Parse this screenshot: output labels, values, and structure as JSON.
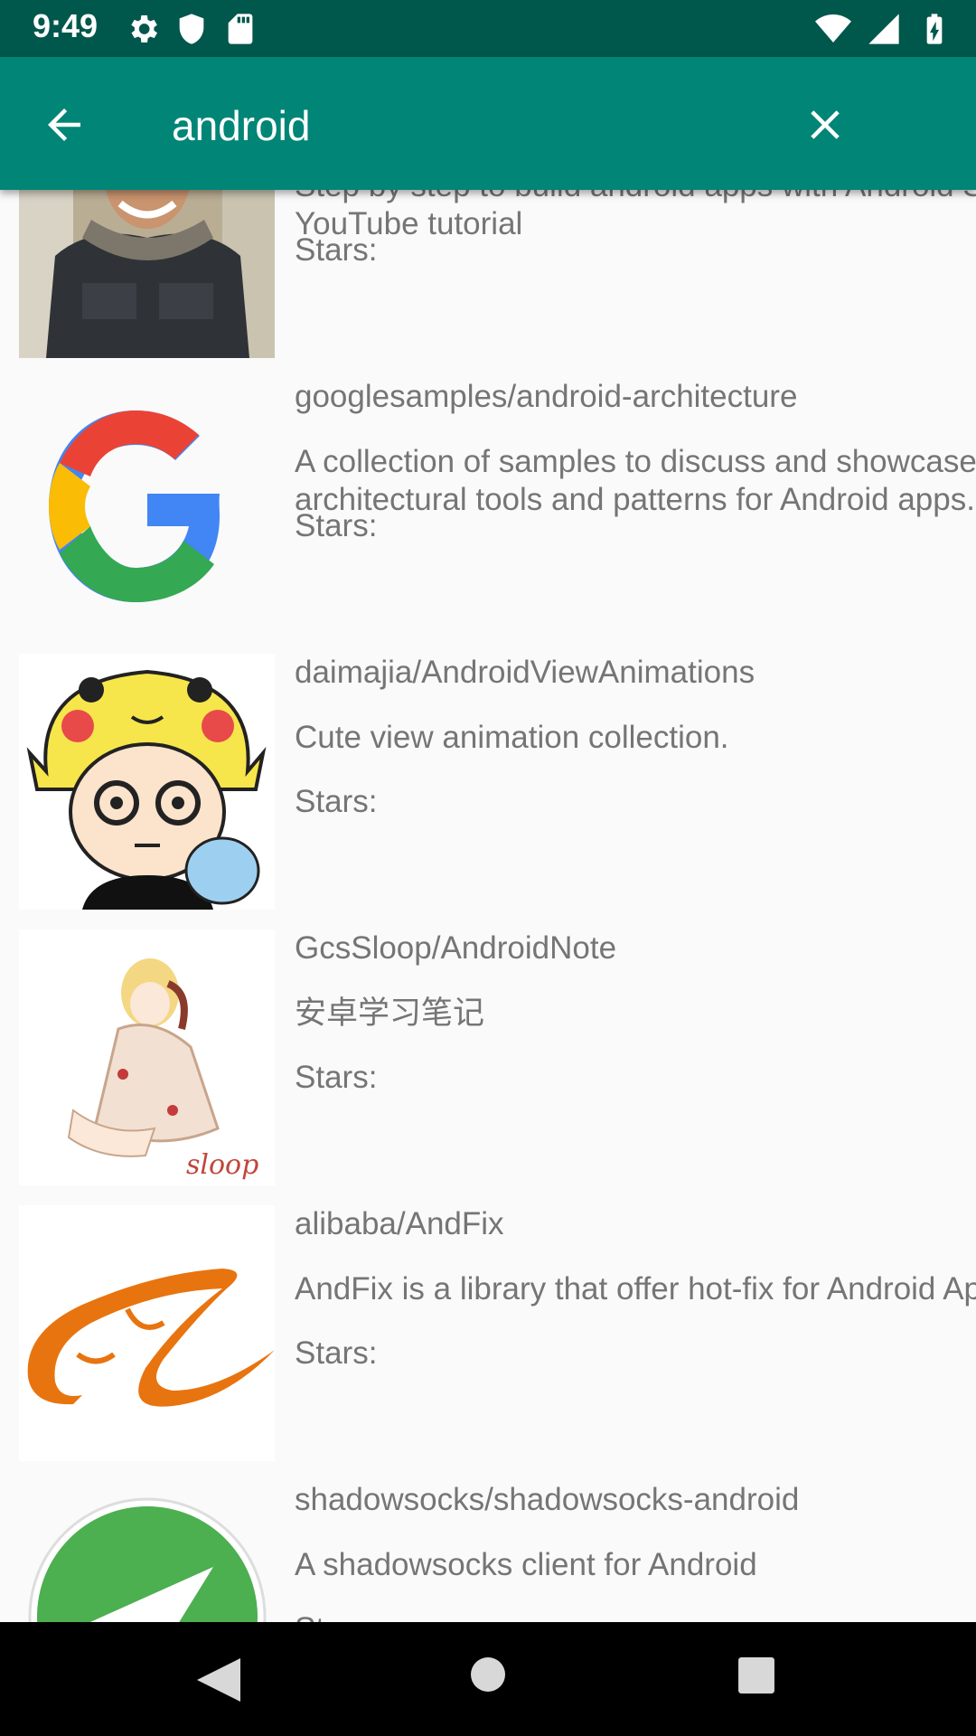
{
  "status_bar": {
    "time": "9:49",
    "icons_left": [
      "settings-icon",
      "shield-icon",
      "sd-card-icon"
    ],
    "icons_right": [
      "wifi-icon",
      "signal-icon",
      "battery-charging-icon"
    ]
  },
  "app_bar": {
    "search_value": "android",
    "background": "#008577",
    "status_background": "#00574b"
  },
  "repos": [
    {
      "name": "",
      "description": "Step by step to build android apps with Android Studio for YouTube tutorial",
      "stars_label": "Stars:",
      "avatar": "person-photo-avatar"
    },
    {
      "name": "googlesamples/android-architecture",
      "description": "A collection of samples to discuss and showcase different architectural tools and patterns for Android apps.",
      "stars_label": "Stars:",
      "avatar": "google-logo-avatar"
    },
    {
      "name": "daimajia/AndroidViewAnimations",
      "description": "Cute view animation collection.",
      "stars_label": "Stars:",
      "avatar": "cartoon-pikachu-hat-avatar"
    },
    {
      "name": "GcsSloop/AndroidNote",
      "description": "安卓学习笔记",
      "stars_label": "Stars:",
      "avatar": "anime-girl-avatar",
      "avatar_text": "sloop"
    },
    {
      "name": "alibaba/AndFix",
      "description": "AndFix is a library that offer hot-fix for Android App.",
      "stars_label": "Stars:",
      "avatar": "alibaba-logo-avatar"
    },
    {
      "name": "shadowsocks/shadowsocks-android",
      "description": "A shadowsocks client for Android",
      "stars_label": "Stars:",
      "avatar": "shadowsocks-logo-avatar"
    }
  ],
  "nav_bar": {
    "buttons": [
      "back",
      "home",
      "recents"
    ]
  }
}
